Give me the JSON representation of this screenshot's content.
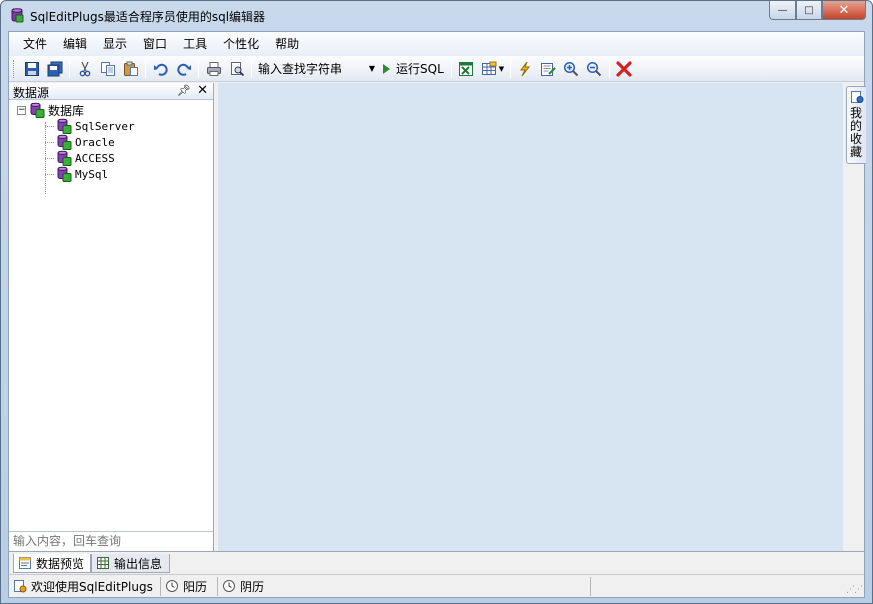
{
  "window": {
    "title": "SqlEditPlugs最适合程序员使用的sql编辑器"
  },
  "window_buttons": {
    "minimize": "—",
    "maximize": "□",
    "close": "✕"
  },
  "menu": [
    "文件",
    "编辑",
    "显示",
    "窗口",
    "工具",
    "个性化",
    "帮助"
  ],
  "toolbar": {
    "search_combo": "输入查找字符串",
    "run_label": "运行SQL"
  },
  "datasource": {
    "title": "数据源",
    "root": "数据库",
    "items": [
      "SqlServer",
      "Oracle",
      "ACCESS",
      "MySql"
    ],
    "search_placeholder": "输入内容，回车查询"
  },
  "favorites": {
    "label": "我的收藏"
  },
  "bottom_tabs": [
    "数据预览",
    "输出信息"
  ],
  "status": {
    "welcome": "欢迎使用SqlEditPlugs",
    "solar": "阳历",
    "lunar": "阴历"
  },
  "colors": {
    "doc_background": "#d7e4f1",
    "close_red": "#c7432a"
  }
}
